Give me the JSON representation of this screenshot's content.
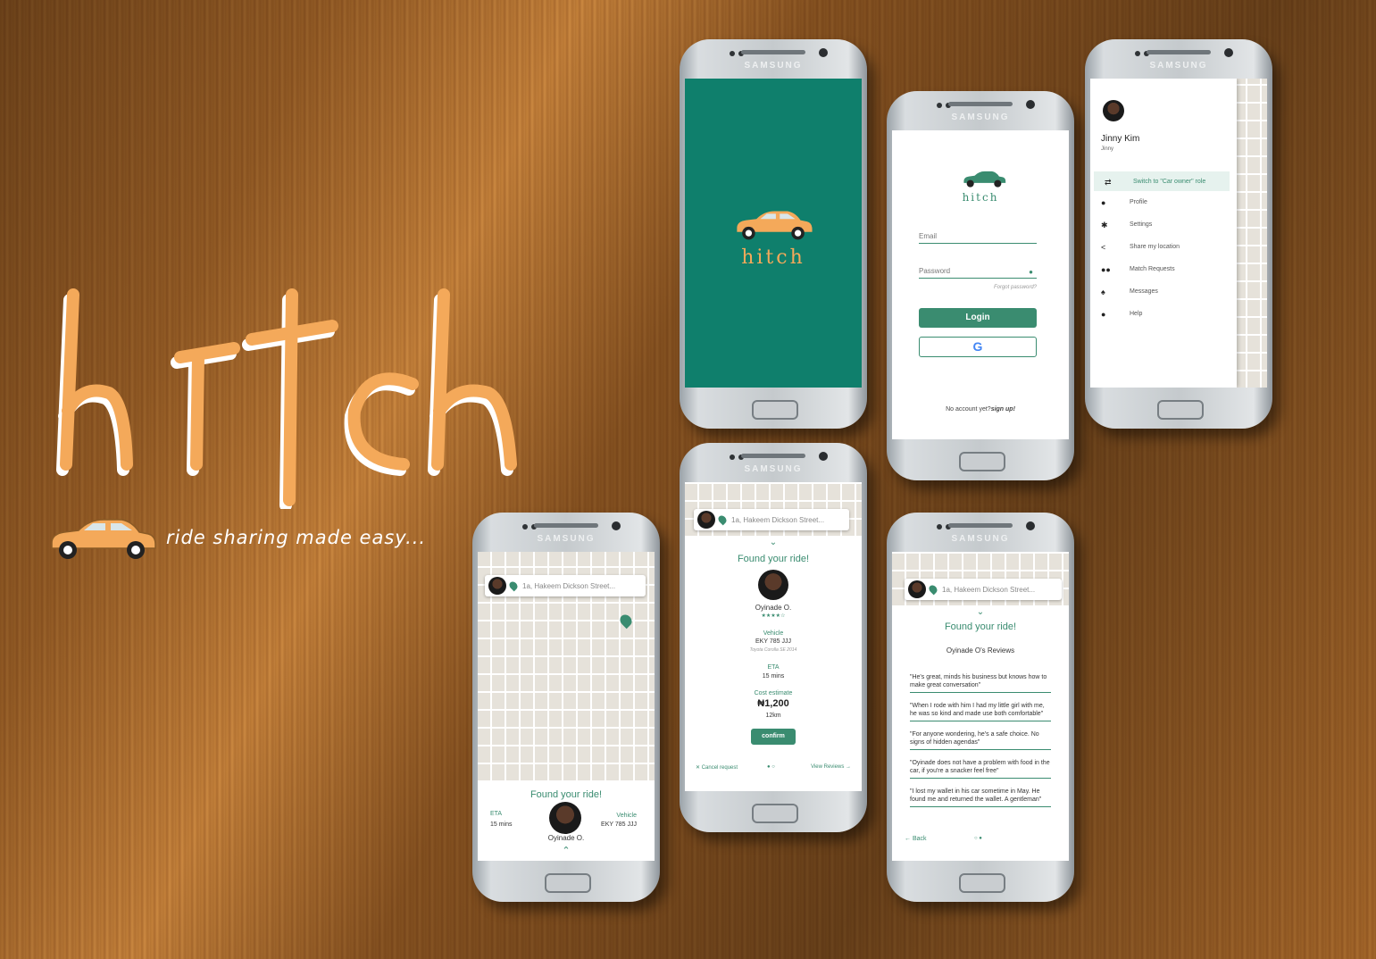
{
  "hero": {
    "title": "hitch",
    "tagline": "ride sharing made easy..."
  },
  "colors": {
    "brand": "#3a8c70",
    "accent": "#f4a95a",
    "splash": "#0f7f6c"
  },
  "phones": {
    "brand_label": "SAMSUNG",
    "splash": {
      "logo": "hitch"
    },
    "login": {
      "logo": "hitch",
      "email_placeholder": "Email",
      "password_placeholder": "Password",
      "forgot": "Forgot password?",
      "login_label": "Login",
      "no_account": "No account yet?",
      "signup": "sign up!"
    },
    "menu": {
      "name": "Jinny Kim",
      "username": "Jinny",
      "items": [
        {
          "icon": "swap-icon",
          "label": "Switch to \"Car owner\" role"
        },
        {
          "icon": "person-icon",
          "label": "Profile"
        },
        {
          "icon": "gear-icon",
          "label": "Settings"
        },
        {
          "icon": "share-icon",
          "label": "Share my location"
        },
        {
          "icon": "group-icon",
          "label": "Match Requests"
        },
        {
          "icon": "bell-icon",
          "label": "Messages"
        },
        {
          "icon": "info-icon",
          "label": "Help"
        }
      ]
    },
    "map_view": {
      "search": "1a, Hakeem Dickson Street...",
      "found": "Found your ride!",
      "eta_label": "ETA",
      "eta": "15 mins",
      "vehicle_label": "Vehicle",
      "vehicle": "EKY 785 JJJ",
      "driver": "Oyinade O."
    },
    "details": {
      "search": "1a, Hakeem Dickson Street...",
      "found": "Found your ride!",
      "driver": "Oyinade O.",
      "stars": "★★★★☆",
      "vehicle_label": "Vehicle",
      "vehicle": "EKY 785 JJJ",
      "car_model": "Toyota Corolla SE 2014",
      "eta_label": "ETA",
      "eta": "15 mins",
      "cost_label": "Cost estimate",
      "cost": "₦1,200",
      "distance": "12km",
      "confirm": "confirm",
      "cancel": "Cancel request",
      "view_reviews": "View Reviews"
    },
    "reviews": {
      "search": "1a, Hakeem Dickson Street...",
      "found": "Found your ride!",
      "heading": "Oyinade O's Reviews",
      "items": [
        "\"He's great, minds his business but knows how to make great conversation\"",
        "\"When I rode with him I had my little girl with me, he was so kind and made use both comfortable\"",
        "\"For anyone wondering, he's a safe choice. No signs of hidden agendas\"",
        "\"Oyinade does not have a problem with food in the car, if you're a snacker feel free\"",
        "\"I lost my wallet in his car sometime in May. He found me and returned the wallet. A gentleman\""
      ],
      "back": "Back"
    }
  }
}
